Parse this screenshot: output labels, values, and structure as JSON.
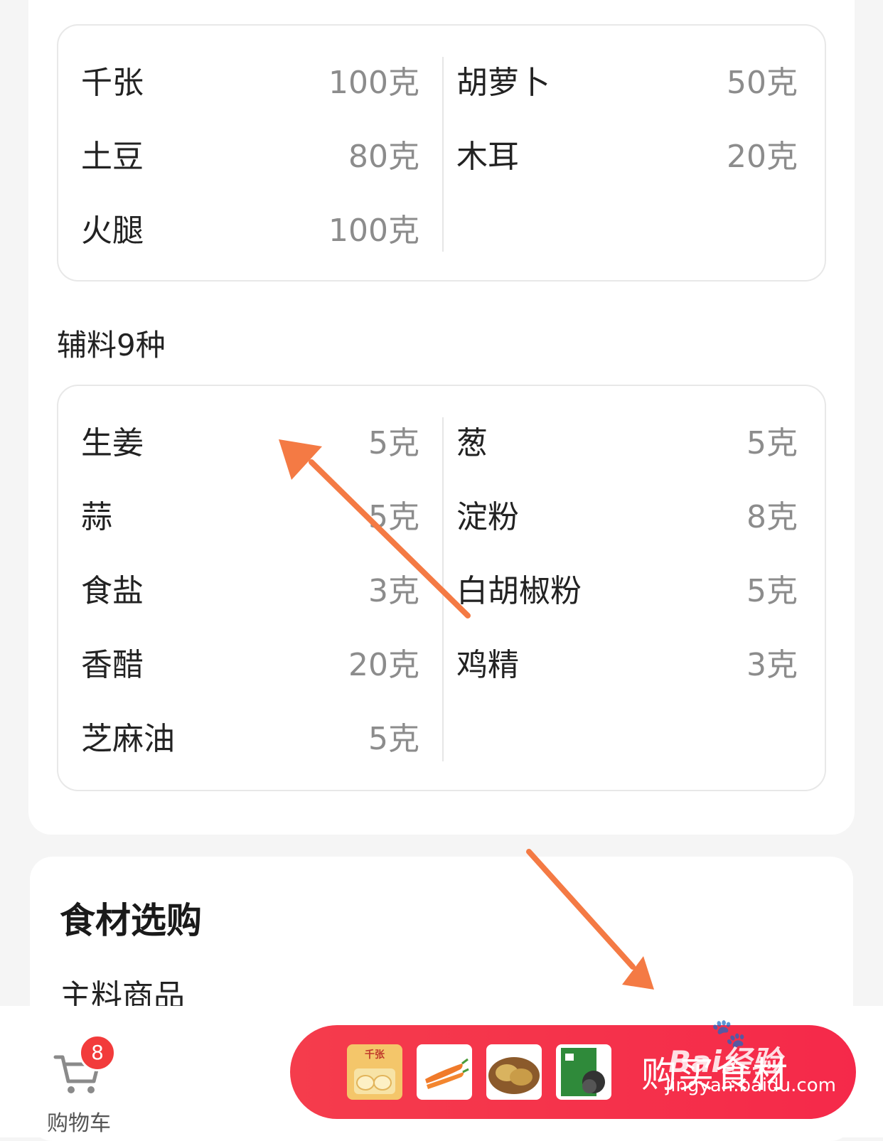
{
  "main_ingredients": {
    "left": [
      {
        "name": "千张",
        "amount": "100克"
      },
      {
        "name": "土豆",
        "amount": "80克"
      },
      {
        "name": "火腿",
        "amount": "100克"
      }
    ],
    "right": [
      {
        "name": "胡萝卜",
        "amount": "50克"
      },
      {
        "name": "木耳",
        "amount": "20克"
      }
    ]
  },
  "aux_section": {
    "title": "辅料9种"
  },
  "aux_ingredients": {
    "left": [
      {
        "name": "生姜",
        "amount": "5克"
      },
      {
        "name": "蒜",
        "amount": "5克"
      },
      {
        "name": "食盐",
        "amount": "3克"
      },
      {
        "name": "香醋",
        "amount": "20克"
      },
      {
        "name": "芝麻油",
        "amount": "5克"
      }
    ],
    "right": [
      {
        "name": "葱",
        "amount": "5克"
      },
      {
        "name": "淀粉",
        "amount": "8克"
      },
      {
        "name": "白胡椒粉",
        "amount": "5克"
      },
      {
        "name": "鸡精",
        "amount": "3克"
      }
    ]
  },
  "shopping": {
    "title": "食材选购",
    "subtitle": "主料商品"
  },
  "bottom_bar": {
    "cart_label": "购物车",
    "cart_badge": "8",
    "buy_label": "购买食材",
    "thumb_label": "千张",
    "thumbnails": [
      "qianzhang-thumb",
      "carrot-thumb",
      "potato-thumb",
      "fungus-thumb"
    ]
  },
  "watermark": {
    "text": "Bai经验",
    "url": "jingyan.baidu.com"
  },
  "colors": {
    "accent": "#f53c4c",
    "arrow": "#f47a44",
    "muted": "#8c8c8c"
  }
}
